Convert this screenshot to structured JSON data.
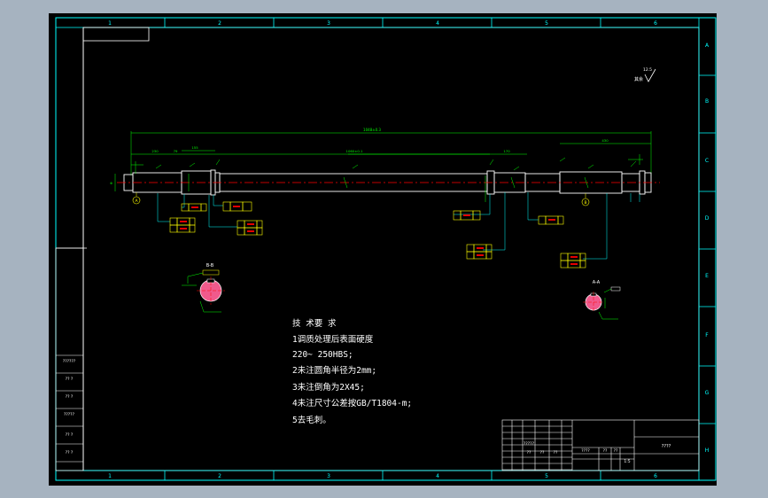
{
  "colors": {
    "viewport_bg": "#a6b3c0",
    "drawing_bg": "#000000",
    "frame": "#00ffff",
    "geometry": "#ffffff",
    "dimension": "#00ff00",
    "leader": "#00ffff",
    "centerline": "#ff0000",
    "section_fill": "#f05a8c",
    "gdt_box": "#ffff00",
    "gdt_text": "#ff0000",
    "datum_label": "#ffff00"
  },
  "frame": {
    "top_zones": [
      "1",
      "2",
      "3",
      "4",
      "5",
      "6"
    ],
    "bottom_zones": [
      "1",
      "2",
      "3",
      "4",
      "5",
      "6"
    ],
    "right_zones": [
      "A",
      "B",
      "C",
      "D",
      "E",
      "F",
      "G",
      "H"
    ]
  },
  "surface_finish": {
    "value": "12.5",
    "label": "其余"
  },
  "shaft": {
    "overall_dim": "1048±0.3",
    "segment_dims": [
      "230",
      "79",
      "155",
      "1060±0.1",
      "170",
      "430"
    ],
    "datum_markers": [
      "A",
      "B"
    ]
  },
  "sections": {
    "b": {
      "label": "B-B"
    },
    "a": {
      "label": "A-A"
    }
  },
  "tech_notes": {
    "title": "技 术要 求",
    "lines": [
      "1调质处理后表面硬度",
      "220~ 250HBS;",
      "2未注圆角半径为2mm;",
      "3未注倒角为2X45;",
      "4未注尺寸公差按GB/T1804-m;",
      "5去毛刺。"
    ]
  },
  "side_table": {
    "labels": [
      "??????",
      "?? ?",
      "?? ?",
      "?????",
      "?? ?",
      "?? ?"
    ]
  },
  "title_block": {
    "drawing_name": "????",
    "cells": [
      "?????",
      "????",
      "??",
      "??",
      "1:5",
      "??",
      "??",
      "??"
    ]
  }
}
